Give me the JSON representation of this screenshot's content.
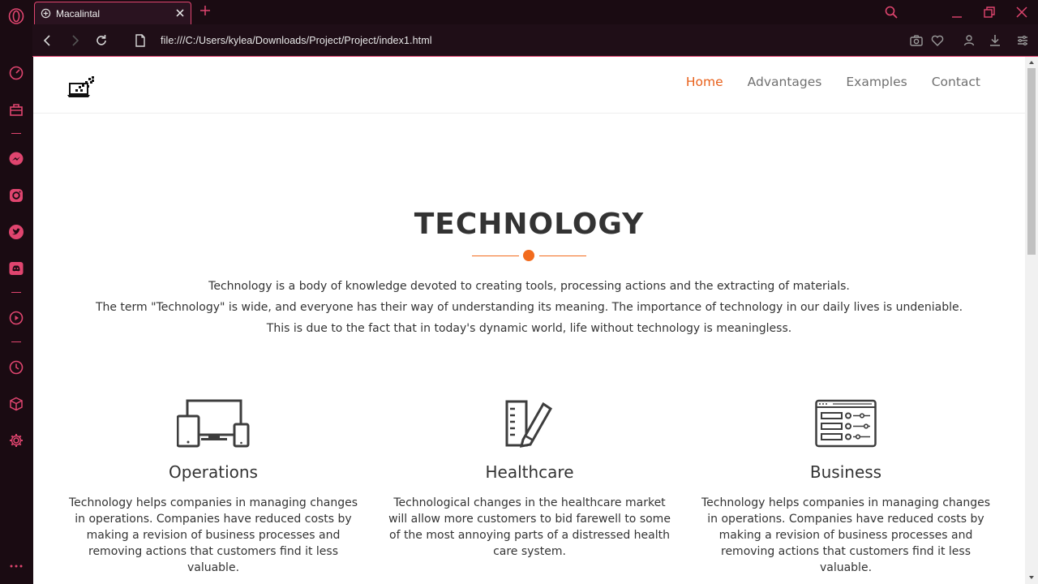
{
  "browser": {
    "tab_title": "Macalintal",
    "url": "file:///C:/Users/kylea/Downloads/Project/Project/index1.html",
    "accent_color": "#e0456f",
    "sidebar_icons": [
      "opera-icon",
      "speed-dial-icon",
      "workspace-icon",
      "messenger-icon",
      "instagram-icon",
      "twitter-icon",
      "discord-icon",
      "player-icon",
      "history-icon",
      "extensions-icon",
      "settings-icon",
      "more-icon"
    ]
  },
  "site": {
    "nav": [
      {
        "label": "Home"
      },
      {
        "label": "Advantages"
      },
      {
        "label": "Examples"
      },
      {
        "label": "Contact"
      }
    ],
    "accent_color": "#e8601a",
    "hero": {
      "title": "TECHNOLOGY",
      "lines": [
        "Technology is a body of knowledge devoted to creating tools, processing actions and the extracting of materials.",
        "The term \"Technology\" is wide, and everyone has their way of understanding its meaning. The importance of technology in our daily lives is undeniable.",
        "This is due to the fact that in today's dynamic world, life without technology is meaningless."
      ]
    },
    "features": [
      {
        "title": "Operations",
        "icon": "devices-icon",
        "text": "Technology helps companies in managing changes in operations. Companies have reduced costs by making a revision of business processes and removing actions that customers find it less valuable."
      },
      {
        "title": "Healthcare",
        "icon": "clipboard-pen-icon",
        "text": "Technological changes in the healthcare market will allow more customers to bid farewell to some of the most annoying parts of a distressed health care system."
      },
      {
        "title": "Business",
        "icon": "dashboard-window-icon",
        "text": "Technology helps companies in managing changes in operations. Companies have reduced costs by making a revision of business processes and removing actions that customers find it less valuable."
      }
    ]
  }
}
